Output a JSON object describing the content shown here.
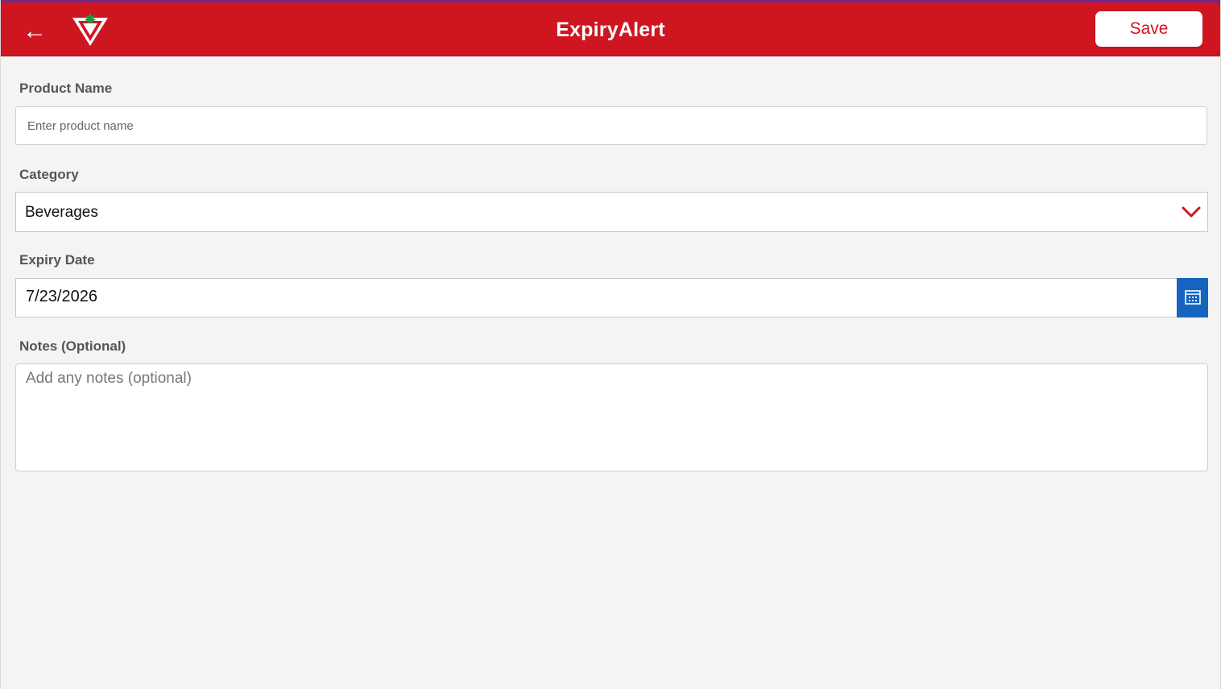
{
  "header": {
    "title": "ExpiryAlert",
    "back_icon": "arrow-left-icon",
    "back_glyph": "←",
    "logo_icon": "triangle-maple-leaf-logo",
    "save_label": "Save",
    "brand_color": "#cf1520",
    "accent_color": "#6e2a8a"
  },
  "form": {
    "product_name": {
      "label": "Product Name",
      "value": "",
      "placeholder": "Enter product name"
    },
    "category": {
      "label": "Category",
      "selected": "Beverages",
      "icon": "chevron-down-icon"
    },
    "expiry_date": {
      "label": "Expiry Date",
      "value": "7/23/2026",
      "icon": "calendar-icon",
      "button_color": "#1565c0"
    },
    "notes": {
      "label": "Notes (Optional)",
      "value": "",
      "placeholder": "Add any notes (optional)"
    }
  }
}
